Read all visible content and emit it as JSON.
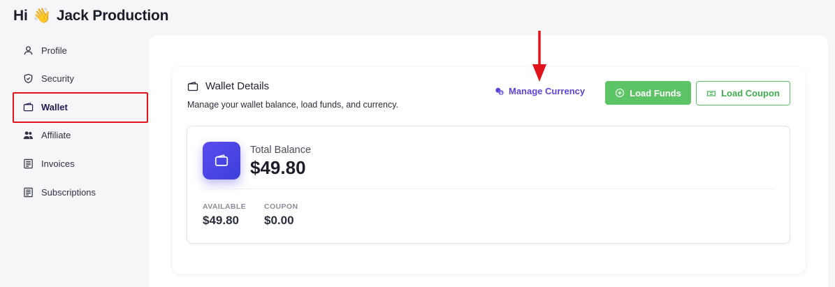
{
  "header": {
    "greeting_prefix": "Hi",
    "wave": "👋",
    "user_name": "Jack Production"
  },
  "sidebar": {
    "items": [
      {
        "label": "Profile",
        "icon": "user-icon"
      },
      {
        "label": "Security",
        "icon": "shield-icon"
      },
      {
        "label": "Wallet",
        "icon": "wallet-icon",
        "active": true
      },
      {
        "label": "Affiliate",
        "icon": "users-icon"
      },
      {
        "label": "Invoices",
        "icon": "receipt-icon"
      },
      {
        "label": "Subscriptions",
        "icon": "receipt-icon"
      }
    ]
  },
  "wallet": {
    "title": "Wallet Details",
    "subtitle": "Manage your wallet balance, load funds, and currency.",
    "manage_currency_label": "Manage Currency",
    "load_funds_label": "Load Funds",
    "load_coupon_label": "Load Coupon",
    "total_balance_label": "Total Balance",
    "total_balance_value": "$49.80",
    "available_label": "AVAILABLE",
    "available_value": "$49.80",
    "coupon_label": "COUPON",
    "coupon_value": "$0.00"
  },
  "colors": {
    "accent_purple": "#5a45d4",
    "success_green": "#5cc465",
    "annotation_red": "#e2141b"
  }
}
